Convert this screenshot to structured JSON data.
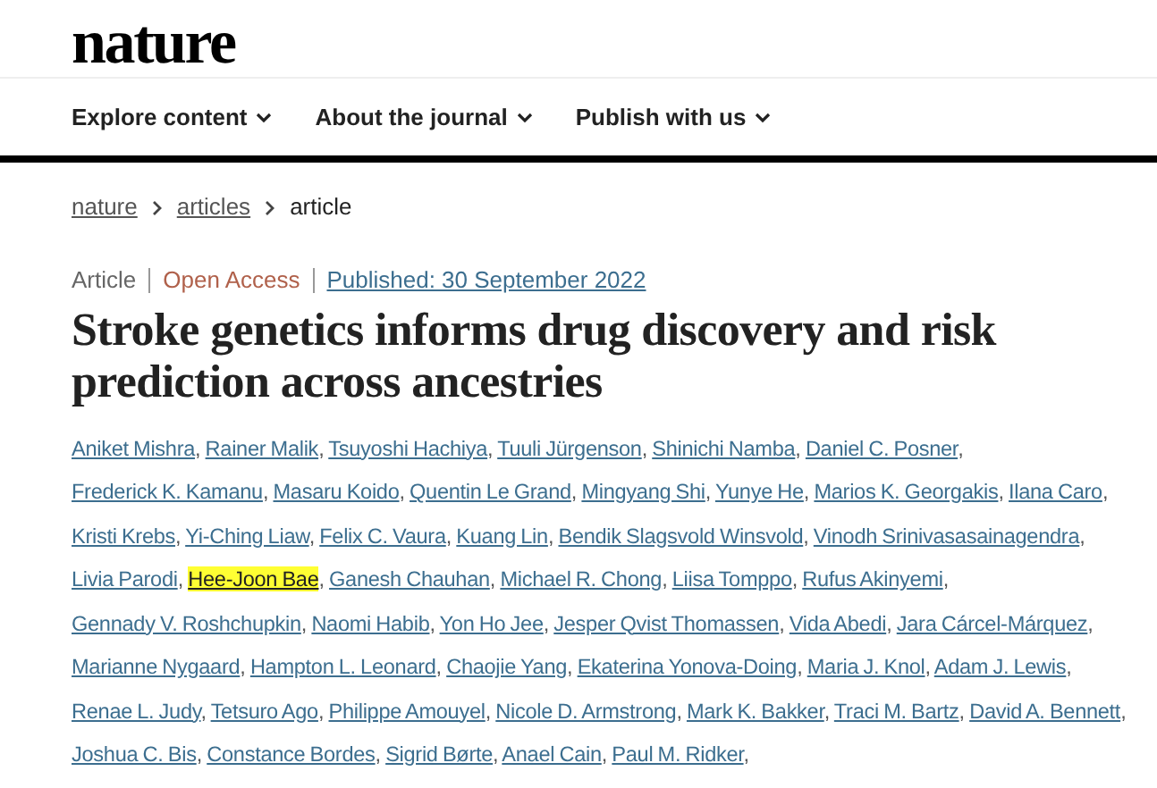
{
  "logo": "nature",
  "nav": [
    {
      "label": "Explore content"
    },
    {
      "label": "About the journal"
    },
    {
      "label": "Publish with us"
    }
  ],
  "breadcrumb": [
    {
      "label": "nature",
      "link": true
    },
    {
      "label": "articles",
      "link": true
    },
    {
      "label": "article",
      "link": false
    }
  ],
  "meta": {
    "type": "Article",
    "access": "Open Access",
    "published": "Published: 30 September 2022"
  },
  "title": "Stroke genetics informs drug discovery and risk prediction across ancestries",
  "authors": [
    {
      "name": "Aniket Mishra",
      "separator": ",",
      "highlighted": false
    },
    {
      "name": "Rainer Malik",
      "separator": ",",
      "highlighted": false
    },
    {
      "name": "Tsuyoshi Hachiya",
      "separator": ",",
      "highlighted": false
    },
    {
      "name": "Tuuli Jürgenson",
      "separator": ",",
      "highlighted": false
    },
    {
      "name": "Shinichi Namba",
      "separator": ",",
      "highlighted": false
    },
    {
      "name": "Daniel C. Posner",
      "separator": ",",
      "highlighted": false
    },
    {
      "name": "Frederick K. Kamanu",
      "separator": ",",
      "highlighted": false
    },
    {
      "name": "Masaru Koido",
      "separator": ",",
      "highlighted": false
    },
    {
      "name": "Quentin Le Grand",
      "separator": ",",
      "highlighted": false
    },
    {
      "name": "Mingyang Shi",
      "separator": ",",
      "highlighted": false
    },
    {
      "name": "Yunye He",
      "separator": ",",
      "highlighted": false
    },
    {
      "name": "Marios K. Georgakis",
      "separator": ",",
      "highlighted": false
    },
    {
      "name": "Ilana Caro",
      "separator": ",",
      "highlighted": false
    },
    {
      "name": "Kristi Krebs",
      "separator": ",",
      "highlighted": false
    },
    {
      "name": "Yi-Ching Liaw",
      "separator": ",",
      "highlighted": false
    },
    {
      "name": "Felix C. Vaura",
      "separator": ",",
      "highlighted": false
    },
    {
      "name": "Kuang Lin",
      "separator": ",",
      "highlighted": false
    },
    {
      "name": "Bendik Slagsvold Winsvold",
      "separator": ",",
      "highlighted": false
    },
    {
      "name": "Vinodh Srinivasasainagendra",
      "separator": ",",
      "highlighted": false
    },
    {
      "name": "Livia Parodi",
      "separator": ",",
      "highlighted": false
    },
    {
      "name": "Hee-Joon Bae",
      "separator": ",",
      "highlighted": true
    },
    {
      "name": "Ganesh Chauhan",
      "separator": ",",
      "highlighted": false
    },
    {
      "name": "Michael R. Chong",
      "separator": ",",
      "highlighted": false
    },
    {
      "name": "Liisa Tomppo",
      "separator": ",",
      "highlighted": false
    },
    {
      "name": "Rufus Akinyemi",
      "separator": ",",
      "highlighted": false
    },
    {
      "name": "Gennady V. Roshchupkin",
      "separator": ",",
      "highlighted": false
    },
    {
      "name": "Naomi Habib",
      "separator": ",",
      "highlighted": false
    },
    {
      "name": "Yon Ho Jee",
      "separator": ",",
      "highlighted": false
    },
    {
      "name": "Jesper Qvist Thomassen",
      "separator": ",",
      "highlighted": false
    },
    {
      "name": "Vida Abedi",
      "separator": ",",
      "highlighted": false
    },
    {
      "name": "Jara Cárcel-Márquez",
      "separator": ",",
      "highlighted": false
    },
    {
      "name": "Marianne Nygaard",
      "separator": ",",
      "highlighted": false
    },
    {
      "name": "Hampton L. Leonard",
      "separator": ",",
      "highlighted": false
    },
    {
      "name": "Chaojie Yang",
      "separator": ",",
      "highlighted": false
    },
    {
      "name": "Ekaterina Yonova-Doing",
      "separator": ",",
      "highlighted": false
    },
    {
      "name": "Maria J. Knol",
      "separator": ",",
      "highlighted": false
    },
    {
      "name": "Adam J. Lewis",
      "separator": ",",
      "highlighted": false
    },
    {
      "name": "Renae L. Judy",
      "separator": ",",
      "highlighted": false
    },
    {
      "name": "Tetsuro Ago",
      "separator": ",",
      "highlighted": false
    },
    {
      "name": "Philippe Amouyel",
      "separator": ",",
      "highlighted": false
    },
    {
      "name": "Nicole D. Armstrong",
      "separator": ",",
      "highlighted": false
    },
    {
      "name": "Mark K. Bakker",
      "separator": ",",
      "highlighted": false
    },
    {
      "name": "Traci M. Bartz",
      "separator": ",",
      "highlighted": false
    },
    {
      "name": "David A. Bennett",
      "separator": ",",
      "highlighted": false
    },
    {
      "name": "Joshua C. Bis",
      "separator": ",",
      "highlighted": false
    },
    {
      "name": "Constance Bordes",
      "separator": ",",
      "highlighted": false
    },
    {
      "name": "Sigrid Børte",
      "separator": ",",
      "highlighted": false
    },
    {
      "name": "Anael Cain",
      "separator": ",",
      "highlighted": false
    },
    {
      "name": "Paul M. Ridker",
      "separator": ",",
      "highlighted": false
    }
  ]
}
